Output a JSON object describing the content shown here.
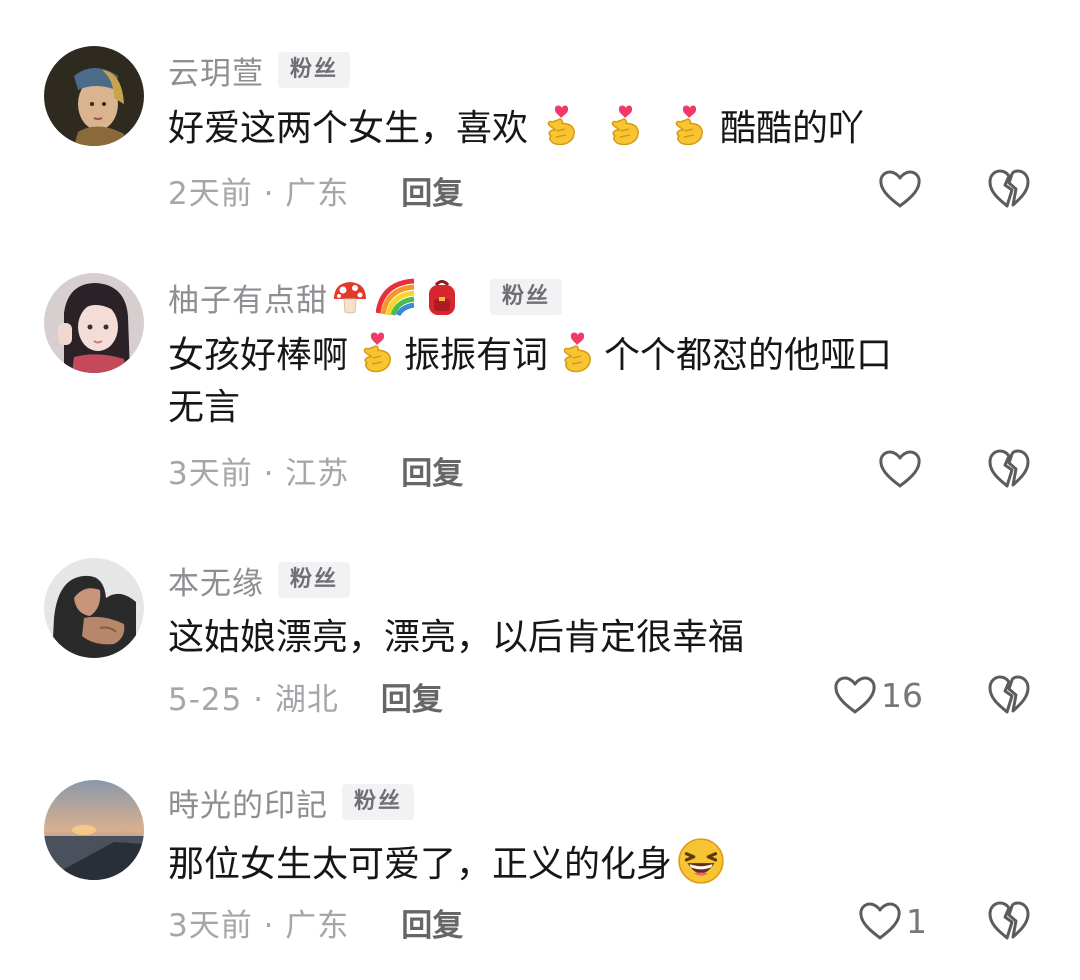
{
  "comments": [
    {
      "username": "云玥萱",
      "badge": "粉丝",
      "text_parts": [
        "好爱这两个女生，喜欢",
        "",
        "",
        "酷酷的吖"
      ],
      "time_location": "2天前 · 广东",
      "reply_label": "回复",
      "like_count": ""
    },
    {
      "username": "柚子有点甜",
      "badge": "粉丝",
      "name_emojis": [
        "mushroom-icon",
        "rainbow-icon",
        "backpack-icon"
      ],
      "text_line1_parts": [
        "女孩好棒啊",
        "振振有词",
        "个个都怼的他哑口"
      ],
      "text_line2": "无言",
      "time_location": "3天前 · 江苏",
      "reply_label": "回复",
      "like_count": ""
    },
    {
      "username": "本无缘",
      "badge": "粉丝",
      "text": "这姑娘漂亮，漂亮，以后肯定很幸福",
      "time_location": "5-25 · 湖北",
      "reply_label": "回复",
      "like_count": "16"
    },
    {
      "username": "時光的印記",
      "badge": "粉丝",
      "text": "那位女生太可爱了，正义的化身",
      "time_location": "3天前 · 广东",
      "reply_label": "回复",
      "like_count": "1"
    }
  ],
  "icons": {
    "like": "heart-outline-icon",
    "dislike": "broken-heart-icon",
    "heart_hands": "finger-heart-emoji-icon",
    "laugh": "grinning-squint-emoji-icon"
  },
  "colors": {
    "username": "#8e8e93",
    "text": "#161616",
    "meta": "#a5a5aa",
    "reply": "#666666"
  }
}
